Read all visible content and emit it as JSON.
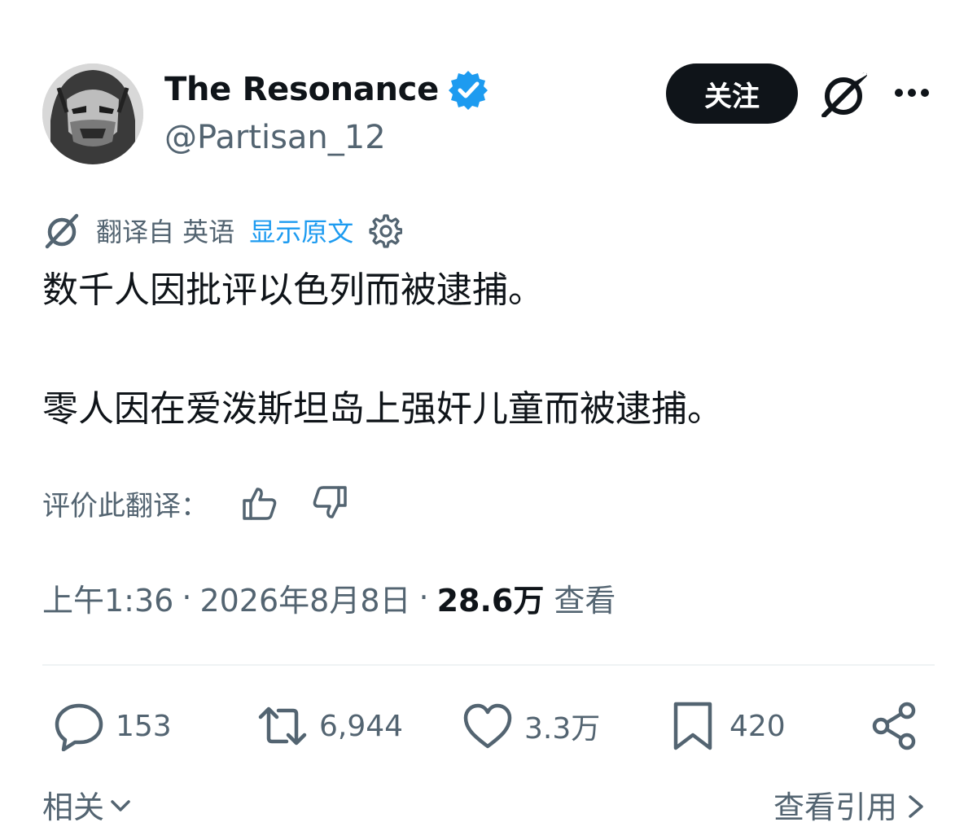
{
  "author": {
    "display_name": "The Resonance",
    "handle": "@Partisan_12",
    "verified_icon": "verified-badge-icon",
    "avatar": "avatar"
  },
  "header": {
    "follow_label": "关注",
    "grok_icon": "grok-icon",
    "more_icon": "more-icon"
  },
  "translation": {
    "translated_from": "翻译自 英语",
    "show_original": "显示原文",
    "settings_icon": "gear-icon",
    "rate_label": "评价此翻译："
  },
  "tweet": {
    "line1": "数千人因批评以色列而被逮捕。",
    "line2": "零人因在爱泼斯坦岛上强奸儿童而被逮捕。"
  },
  "meta": {
    "time": "上午1:36",
    "date": "2026年8月8日",
    "separator": "·",
    "views_count": "28.6万",
    "views_label": "查看"
  },
  "actions": {
    "replies": "153",
    "reposts": "6,944",
    "likes": "3.3万",
    "bookmarks": "420"
  },
  "footer": {
    "related_label": "相关",
    "view_quotes_label": "查看引用"
  },
  "colors": {
    "text_primary": "#0f1419",
    "text_secondary": "#536471",
    "link_blue": "#1d9bf0",
    "divider": "#eff3f4"
  }
}
